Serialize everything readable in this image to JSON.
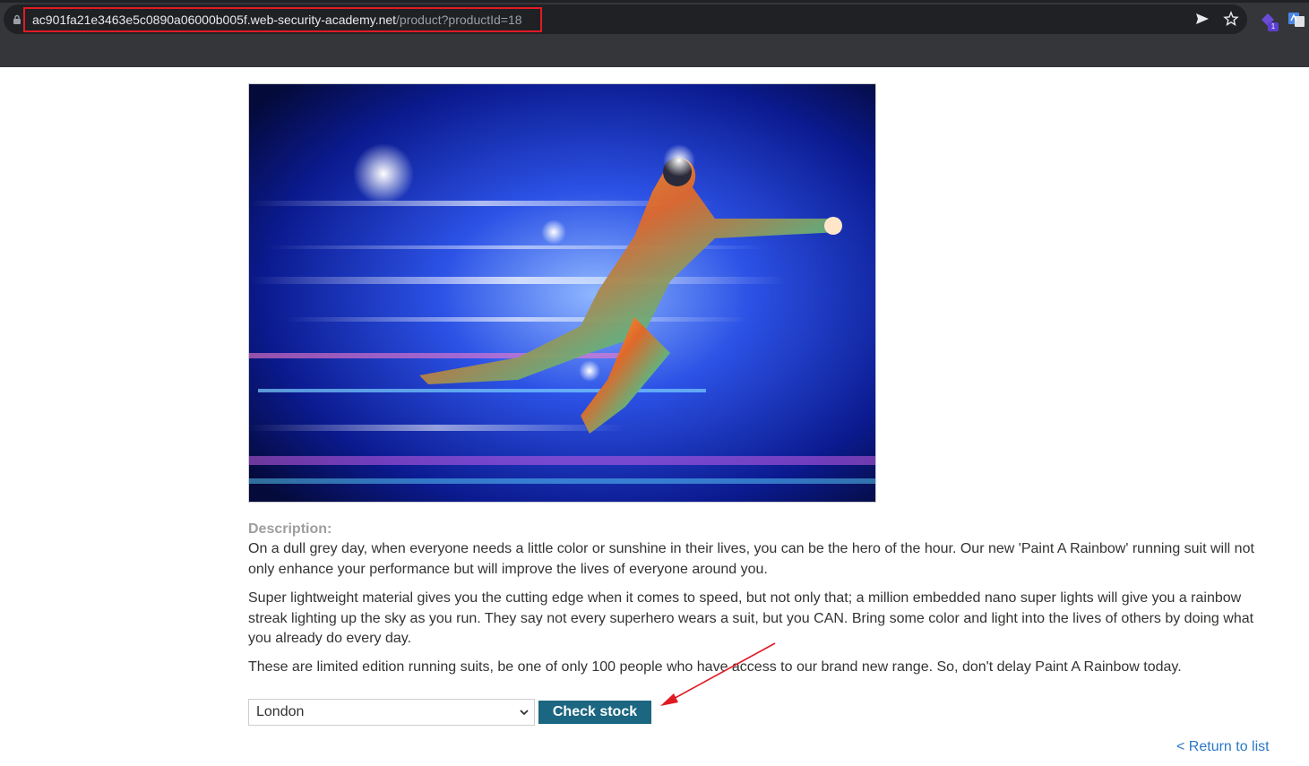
{
  "browser": {
    "url_host": "ac901fa21e3463e5c0890a06000b005f.web-security-academy.net",
    "url_path": "/product?productId=18",
    "extension_badge": "1"
  },
  "product": {
    "description_label": "Description:",
    "description_paragraphs": [
      "On a dull grey day, when everyone needs a little color or sunshine in their lives, you can be the hero of the hour. Our new 'Paint A Rainbow' running suit will not only enhance your performance but will improve the lives of everyone around you.",
      "Super lightweight material gives you the cutting edge when it comes to speed, but not only that; a million embedded nano super lights will give you a rainbow streak lighting up the sky as you run. They say not every superhero wears a suit, but you CAN. Bring some color and light into the lives of others by doing what you already do every day.",
      "These are limited edition running suits, be one of only 100 people who have access to our brand new range. So, don't delay Paint A Rainbow today."
    ]
  },
  "stock": {
    "selected_store": "London",
    "check_button_label": "Check stock"
  },
  "navigation": {
    "return_link": "< Return to list"
  },
  "colors": {
    "accent_button": "#1b6680",
    "link": "#2b78c5",
    "highlight_box": "#e01b24",
    "annotation_arrow": "#e01b24"
  }
}
